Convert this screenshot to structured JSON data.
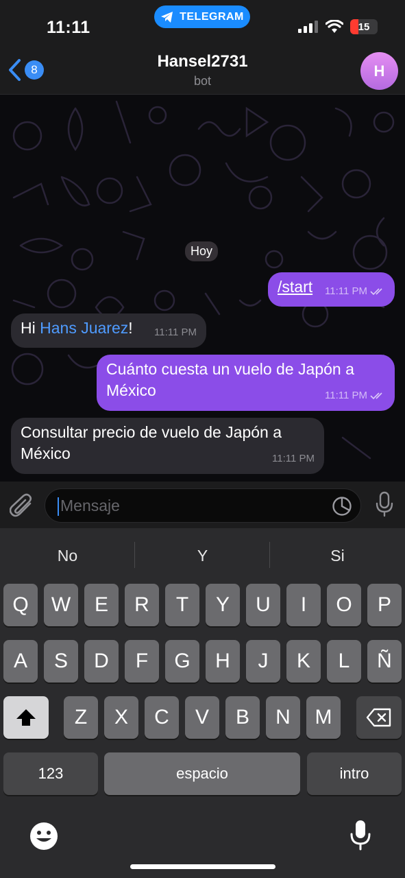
{
  "status_bar": {
    "time": "11:11",
    "app_pill": "TELEGRAM",
    "battery": "15"
  },
  "header": {
    "back_count": "8",
    "title": "Hansel2731",
    "subtitle": "bot",
    "avatar_letter": "H"
  },
  "chat": {
    "date_label": "Hoy",
    "messages": [
      {
        "direction": "out",
        "text": "/start",
        "time": "11:11 PM"
      },
      {
        "direction": "in",
        "prefix": "Hi ",
        "mention": "Hans Juarez",
        "suffix": "!",
        "time": "11:11 PM"
      },
      {
        "direction": "out",
        "line1": "Cuánto cuesta un vuelo de Japón a",
        "line2": "México",
        "time": "11:11 PM"
      },
      {
        "direction": "in",
        "line1": "Consultar precio de vuelo de Japón a",
        "line2": "México",
        "time": "11:11 PM"
      }
    ]
  },
  "input": {
    "placeholder": "Mensaje"
  },
  "keyboard": {
    "suggestions": [
      "No",
      "Y",
      "Si"
    ],
    "row1": [
      "Q",
      "W",
      "E",
      "R",
      "T",
      "Y",
      "U",
      "I",
      "O",
      "P"
    ],
    "row2": [
      "A",
      "S",
      "D",
      "F",
      "G",
      "H",
      "J",
      "K",
      "L",
      "Ñ"
    ],
    "row3": [
      "Z",
      "X",
      "C",
      "V",
      "B",
      "N",
      "M"
    ],
    "numbers_key": "123",
    "space_key": "espacio",
    "return_key": "intro"
  },
  "colors": {
    "accent": "#3a8df5",
    "outgoing_bubble": "#8b4de8",
    "incoming_bubble": "#2b2a30",
    "mention": "#4f9bff"
  }
}
